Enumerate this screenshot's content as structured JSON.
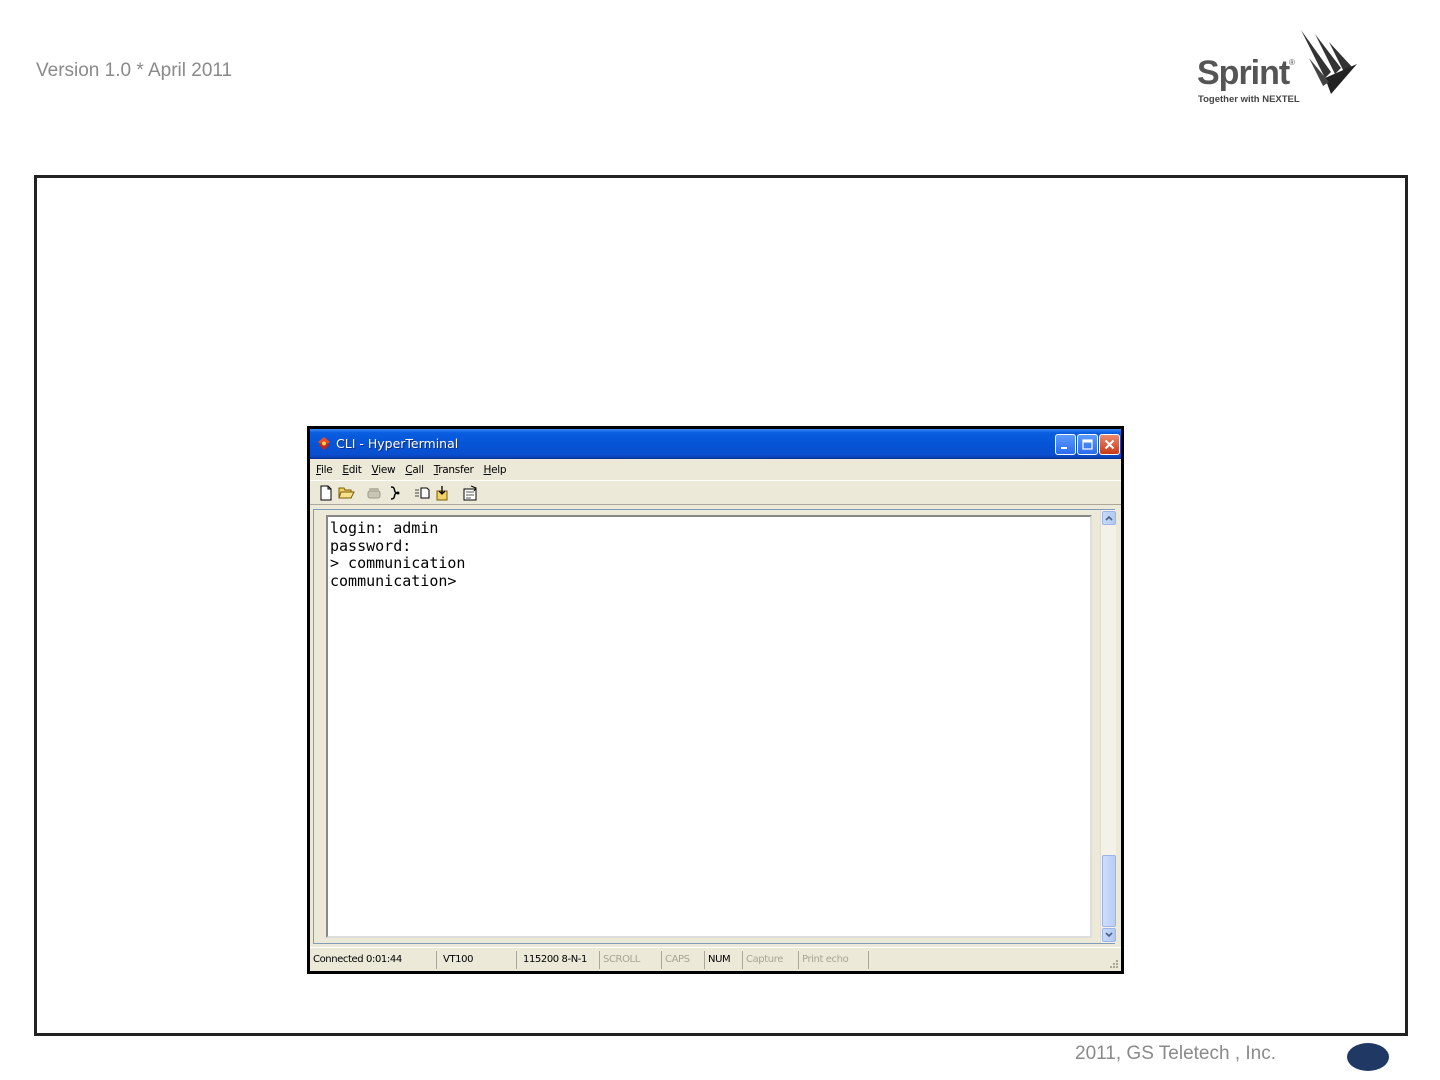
{
  "slide": {
    "version": "Version 1.0 * April 2011",
    "copyright": "2011, GS Teletech , Inc.",
    "logo_word": "Sprint",
    "logo_tm": "®",
    "logo_tagline": "Together with NEXTEL"
  },
  "window": {
    "title": "CLI - HyperTerminal",
    "menus": [
      {
        "first": "F",
        "rest": "ile"
      },
      {
        "first": "E",
        "rest": "dit"
      },
      {
        "first": "V",
        "rest": "iew"
      },
      {
        "first": "C",
        "rest": "all"
      },
      {
        "first": "T",
        "rest": "ransfer"
      },
      {
        "first": "H",
        "rest": "elp"
      }
    ],
    "toolbar_icons": [
      "new-document-icon",
      "open-folder-icon",
      "phone-disconnected-icon",
      "disconnect-icon",
      "send-file-icon",
      "receive-file-icon",
      "properties-icon"
    ]
  },
  "terminal": {
    "lines": [
      "login: admin",
      "password:",
      "> communication",
      "communication>"
    ]
  },
  "statusbar": {
    "connected": "Connected 0:01:44",
    "emulation": "VT100",
    "port_settings": "115200 8-N-1",
    "scroll": "SCROLL",
    "caps": "CAPS",
    "num": "NUM",
    "capture": "Capture",
    "print_echo": "Print echo"
  },
  "colors": {
    "title_bar": "#0554d6",
    "window_face": "#ece9d8",
    "page_dot": "#1f3864",
    "muted_text": "#8a8a8a"
  }
}
